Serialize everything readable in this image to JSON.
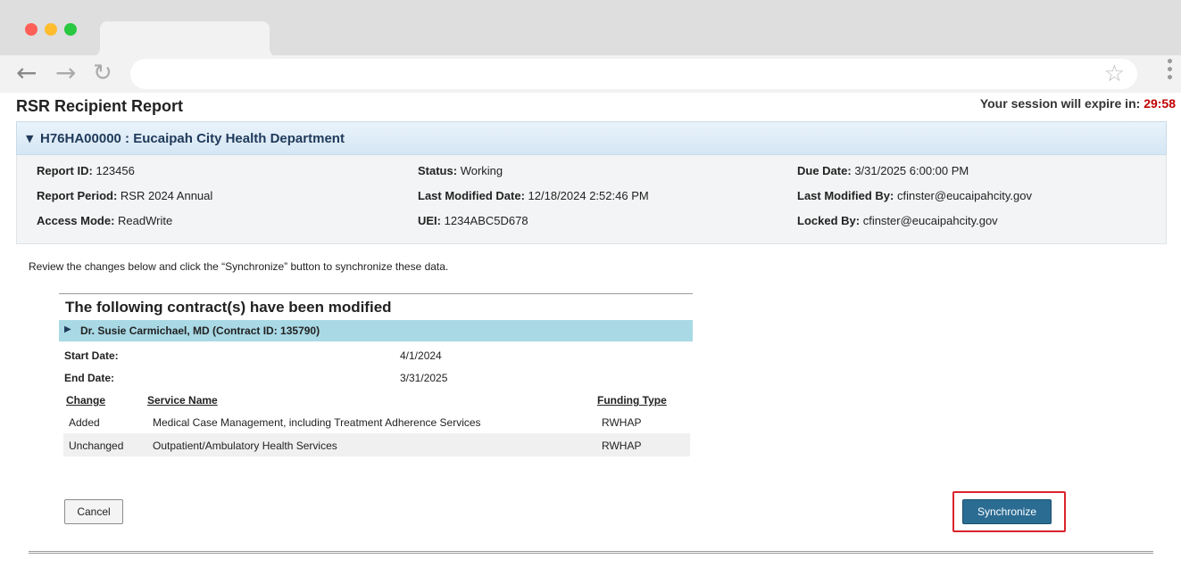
{
  "page": {
    "title": "RSR Recipient Report",
    "session_prefix": "Your session will expire in: ",
    "session_timer": "29:58"
  },
  "panel": {
    "title": "H76HA00000 : Eucaipah City Health Department"
  },
  "info": {
    "report_id_label": "Report ID:",
    "report_id": "123456",
    "report_period_label": "Report Period:",
    "report_period": "RSR 2024 Annual",
    "access_mode_label": "Access Mode:",
    "access_mode": "ReadWrite",
    "status_label": "Status:",
    "status": "Working",
    "last_modified_date_label": "Last Modified Date:",
    "last_modified_date": "12/18/2024 2:52:46 PM",
    "uei_label": "UEI:",
    "uei": "1234ABC5D678",
    "due_date_label": "Due Date:",
    "due_date": "3/31/2025 6:00:00 PM",
    "last_modified_by_label": "Last Modified By:",
    "last_modified_by": "cfinster@eucaipahcity.gov",
    "locked_by_label": "Locked By:",
    "locked_by": "cfinster@eucaipahcity.gov"
  },
  "review": {
    "instruction": "Review the changes below and click the “Synchronize” button to synchronize these data."
  },
  "modified": {
    "heading": "The following contract(s) have been modified",
    "contract_title": "Dr. Susie Carmichael, MD (Contract ID: 135790)",
    "start_date_label": "Start Date:",
    "start_date": "4/1/2024",
    "end_date_label": "End Date:",
    "end_date": "3/31/2025",
    "columns": [
      "Change",
      "Service Name",
      "Funding Type"
    ],
    "rows": [
      {
        "change": "Added",
        "service": "Medical Case Management, including Treatment Adherence Services",
        "funding": "RWHAP"
      },
      {
        "change": "Unchanged",
        "service": "Outpatient/Ambulatory Health Services",
        "funding": "RWHAP"
      }
    ]
  },
  "buttons": {
    "cancel": "Cancel",
    "synchronize": "Synchronize"
  },
  "colors": {
    "accent": "#2b6c93",
    "timer": "#c00000",
    "highlight": "#d9242c",
    "contract_bar": "#a9d9e5"
  }
}
